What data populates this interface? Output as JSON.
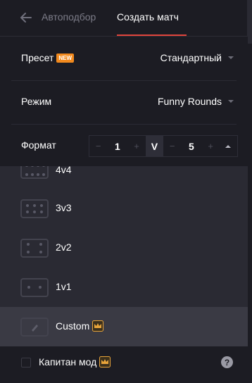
{
  "header": {
    "tab_auto": "Автоподбор",
    "tab_create": "Создать матч"
  },
  "settings": {
    "preset_label": "Пресет",
    "preset_badge": "NEW",
    "preset_value": "Стандартный",
    "mode_label": "Режим",
    "mode_value": "Funny Rounds",
    "format_label": "Формат",
    "format_left": "1",
    "format_vs": "V",
    "format_right": "5",
    "minus": "−",
    "plus": "+"
  },
  "list": {
    "items": [
      {
        "label": "4v4"
      },
      {
        "label": "3v3"
      },
      {
        "label": "2v2"
      },
      {
        "label": "1v1"
      },
      {
        "label": "Custom",
        "selected": true
      }
    ]
  },
  "footer": {
    "captain_label": "Капитан мод",
    "help": "?"
  },
  "colors": {
    "accent": "#e2453c",
    "badge": "#f28a1e",
    "crown": "#e8a43a",
    "background": "#1c1c23",
    "list_background": "#2a2a33"
  }
}
